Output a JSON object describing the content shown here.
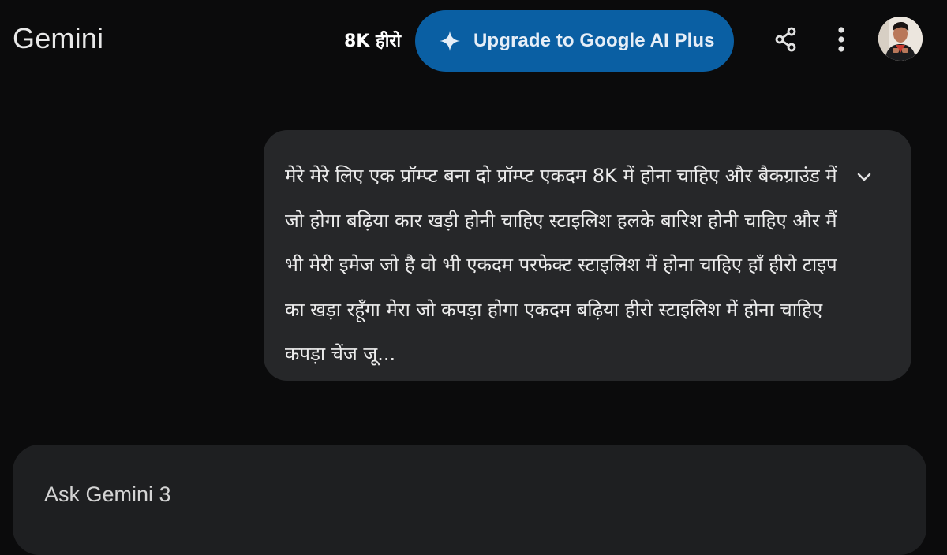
{
  "header": {
    "app_title": "Gemini",
    "chat_title": "8K हीरो",
    "upgrade_label": "Upgrade to Google AI Plus",
    "upgrade_icon": "sparkle-icon",
    "share_icon": "share-icon",
    "more_icon": "more-vert-icon",
    "avatar_icon": "user-avatar"
  },
  "conversation": {
    "user_message": "मेरे मेरे लिए एक प्रॉम्प्ट बना दो प्रॉम्प्ट एकदम 8K में होना चाहिए और बैकग्राउंड में जो होगा बढ़िया कार खड़ी होनी चाहिए स्टाइलिश हलके बारिश होनी चाहिए और मैं भी मेरी इमेज जो है वो भी एकदम परफेक्ट स्टाइलिश में होना चाहिए हाँ हीरो टाइप का खड़ा रहूँगा मेरा जो कपड़ा होगा एकदम बढ़िया हीरो स्टाइलिश में होना चाहिए कपड़ा चेंज जू...",
    "expand_icon": "chevron-down-icon"
  },
  "composer": {
    "placeholder": "Ask Gemini 3"
  },
  "colors": {
    "background": "#0b0b0c",
    "upgrade_button": "#0a5fa3",
    "user_bubble": "#262729",
    "composer": "#1e1f21"
  }
}
